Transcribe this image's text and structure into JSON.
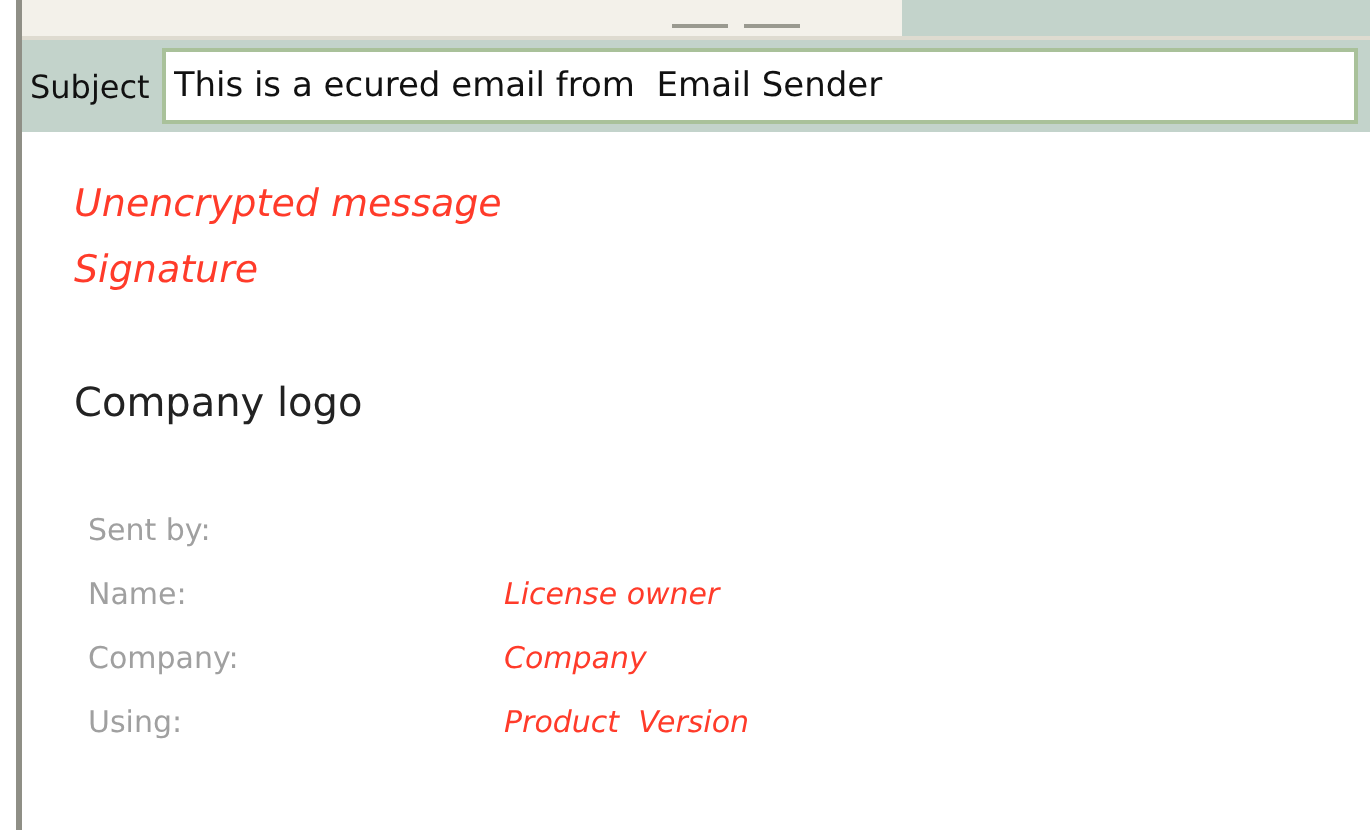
{
  "subject": {
    "label": "Subject",
    "value": "This is a ecured email from  Email Sender"
  },
  "notices": [
    "Unencrypted message",
    "Signature"
  ],
  "logo_text": "Company logo",
  "sent_by": {
    "heading": "Sent by:",
    "rows": [
      {
        "label": "Name:",
        "value": "License owner"
      },
      {
        "label": "Company:",
        "value": "Company"
      },
      {
        "label": "Using:",
        "value": "Product  Version"
      }
    ]
  }
}
